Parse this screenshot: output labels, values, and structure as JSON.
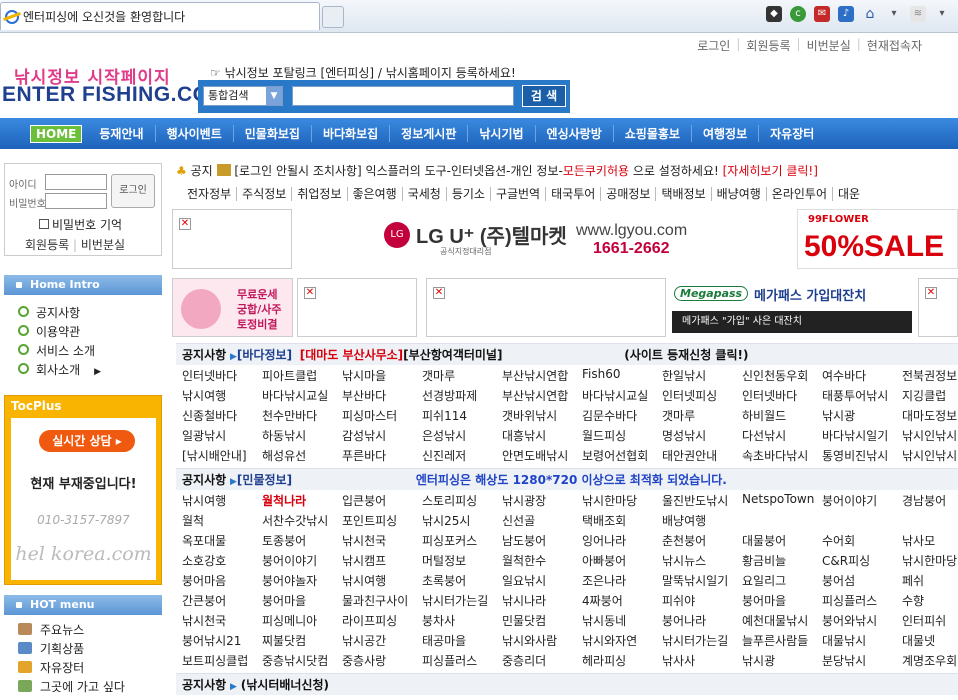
{
  "browser": {
    "tab_title": "엔터피싱에 오신것을 환영합니다"
  },
  "top_links": [
    "로그인",
    "회원등록",
    "비번분실",
    "현재접속자"
  ],
  "logo": {
    "line1": "낚시정보 시작페이지",
    "line2": "ENTER FISHING.COM"
  },
  "portal_text": "☞ 낚시정보 포탈링크 [엔터피싱] / 낚시홈페이지 등록하세요!",
  "search": {
    "select_value": "통합검색",
    "button": "검 색"
  },
  "nav": [
    "HOME",
    "등재안내",
    "행사이벤트",
    "민물화보집",
    "바다화보집",
    "정보게시판",
    "낚시기법",
    "엔싱사랑방",
    "쇼핑몰홍보",
    "여행정보",
    "자유장터"
  ],
  "login": {
    "id_label": "아이디",
    "pw_label": "비밀번호",
    "button": "로그인",
    "remember": "비밀번호 기억",
    "register": "회원등록",
    "lost": "비번분실"
  },
  "home_intro": {
    "title": "Home Intro",
    "items": [
      "공지사항",
      "이용약관",
      "서비스 소개",
      "회사소개"
    ]
  },
  "tocplus": {
    "title": "TocPlus",
    "button": "실시간 상담",
    "status": "현재 부재중입니다!",
    "phone": "010-3157-7897",
    "url": "hel korea.com"
  },
  "hot_menu": {
    "title": "HOT menu",
    "items": [
      "주요뉴스",
      "기획상품",
      "자유장터",
      "그곳에 가고 싶다"
    ]
  },
  "notice": {
    "label": "공지",
    "text": "[로그인 안될시 조치사항] 익스플러의 도구-인터넷옵션-개인 정보-",
    "highlight": "모든쿠키허용",
    "text2": "으로 설정하세요!",
    "link": "[자세히보기 클릭!]"
  },
  "quick_links": [
    "전자정부",
    "주식정보",
    "취업정보",
    "좋은여행",
    "국세청",
    "등기소",
    "구글번역",
    "태국투어",
    "공매정보",
    "택배정보",
    "배냥여행",
    "온라인투어",
    "대운"
  ],
  "ads": {
    "lg_text": "LG U⁺ (주)텔마켓",
    "lg_sub": "공식지정대리점",
    "lg_url": "www.lgyou.com",
    "lg_phone": "1661-2662",
    "flower": "99FLOWER",
    "flower_sale": "50%SALE",
    "fortune1": "무료운세",
    "fortune2": "궁합/사주",
    "fortune3": "토정비결",
    "mega_logo": "Megapass",
    "mega_title": "메가패스 가입대잔치",
    "mega_sub": "메가패스 \"가입\" 사은 대잔치"
  },
  "section_sea": {
    "label": "공지사항",
    "category": "[바다정보]",
    "promo_red": "[대마도 부산사무소]",
    "promo": "[부산항여객터미널]",
    "promo2": "(사이트 등재신청 클릭!)",
    "items": [
      "인터넷바다",
      "피아트클럽",
      "낚시마을",
      "갯마루",
      "부산낚시연합",
      "Fish60",
      "한일낚시",
      "신인천동우회",
      "여수바다",
      "전북권정보",
      "낚시여행",
      "바다낚시교실",
      "부산바다",
      "선경방파제",
      "부산낚시연합",
      "바다낚시교실",
      "인터넷피싱",
      "인터넷바다",
      "태풍투어낚시",
      "지깅클럽",
      "신종철바다",
      "천수만바다",
      "피싱마스터",
      "피쉬114",
      "갯바위낚시",
      "김문수바다",
      "갯마루",
      "하비월드",
      "낚시광",
      "대마도정보",
      "일광낚시",
      "하동낚시",
      "감성낚시",
      "은성낚시",
      "대흥낚시",
      "월드피싱",
      "명성낚시",
      "다선낚시",
      "바다낚시일기",
      "낚시인낚시",
      "[낚시배안내]",
      "해성유선",
      "푸른바다",
      "신진레저",
      "안면도배낚시",
      "보령어선협회",
      "태안권안내",
      "속초바다낚시",
      "통영비진낚시",
      "낚시인낚시"
    ]
  },
  "section_fresh": {
    "label": "공지사항",
    "category": "[민물정보]",
    "optimize": "엔터피싱은 해상도 1280*720 이상으로 최적화 되었습니다.",
    "items": [
      "낚시여행",
      "월척나라",
      "입큰붕어",
      "스토리피싱",
      "낚시광장",
      "낚시한마당",
      "울진반도낚시",
      "NetspoTown",
      "붕어이야기",
      "경남붕어",
      "월척",
      "서찬수갓낚시",
      "포인트피싱",
      "낚시25시",
      "신선골",
      "택배조회",
      "배냥여행",
      "",
      "",
      "",
      "옥포대물",
      "토종붕어",
      "낚시천국",
      "피싱포커스",
      "남도붕어",
      "잉어나라",
      "춘천붕어",
      "대물붕어",
      "수어회",
      "낚사모",
      "소호강호",
      "붕어이야기",
      "낚시캠프",
      "머털정보",
      "월척한수",
      "아빠붕어",
      "낚시뉴스",
      "황금비늘",
      "C&R피싱",
      "낚시한마당",
      "붕어마음",
      "붕어야놀자",
      "낚시여행",
      "초록붕어",
      "일요낚시",
      "조은나라",
      "말뚝낚시일기",
      "요일리그",
      "붕어섬",
      "페쉬",
      "간큰붕어",
      "붕어마을",
      "물과친구사이",
      "낚시터가는길",
      "낚시나라",
      "4짜붕어",
      "피쉬야",
      "붕어마을",
      "피싱플러스",
      "수향",
      "낚시천국",
      "피싱메니아",
      "라이프피싱",
      "붕차사",
      "민물닷컴",
      "낚시동네",
      "붕어나라",
      "예천대물낚시",
      "붕어와낚시",
      "인터피쉬",
      "붕어낚시21",
      "찌불닷컴",
      "낚시공간",
      "태공마을",
      "낚시와사람",
      "낚시와자연",
      "낚시터가는길",
      "늘푸른사람들",
      "대물낚시",
      "대물넷",
      "보트피싱클럽",
      "중층낚시닷컴",
      "중층사랑",
      "피싱플러스",
      "중층리더",
      "헤라피싱",
      "낚사사",
      "낚시광",
      "분당낚시",
      "계명조우회"
    ]
  },
  "section_bottom": {
    "label": "공지사항",
    "text": "(낚시터배너신청)"
  },
  "colors": {
    "nav": "#1d62bb",
    "accent_red": "#d9000c",
    "home": "#6bbf3a"
  }
}
